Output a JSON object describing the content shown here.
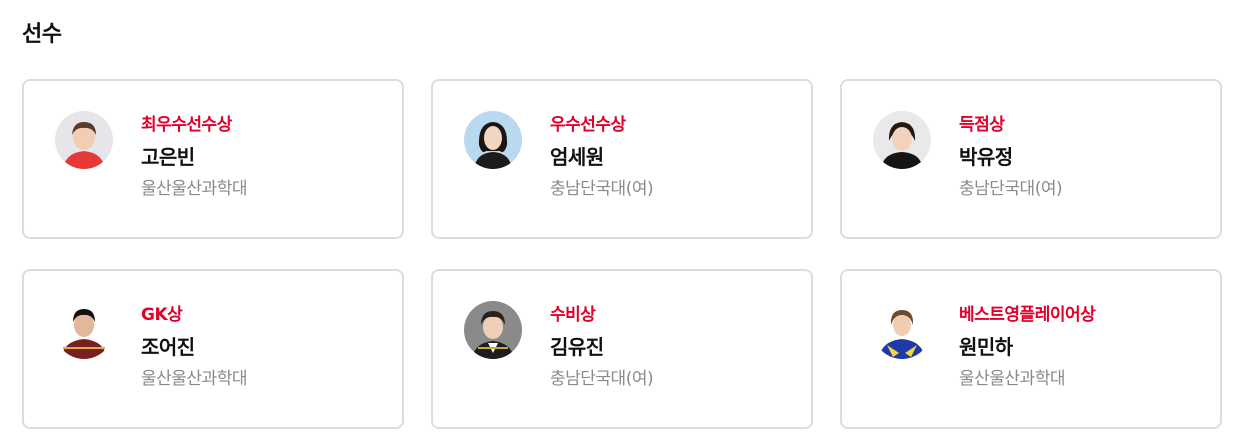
{
  "section": {
    "title": "선수"
  },
  "players": [
    {
      "award": "최우수선수상",
      "name": "고은빈",
      "school": "울산울산과학대"
    },
    {
      "award": "우수선수상",
      "name": "엄세원",
      "school": "충남단국대(여)"
    },
    {
      "award": "득점상",
      "name": "박유정",
      "school": "충남단국대(여)"
    },
    {
      "award": "GK상",
      "name": "조어진",
      "school": "울산울산과학대"
    },
    {
      "award": "수비상",
      "name": "김유진",
      "school": "충남단국대(여)"
    },
    {
      "award": "베스트영플레이어상",
      "name": "원민하",
      "school": "울산울산과학대"
    }
  ],
  "colors": {
    "award_red": "#e0002a",
    "card_border": "#dddddd",
    "muted_text": "#8a8a8a"
  }
}
